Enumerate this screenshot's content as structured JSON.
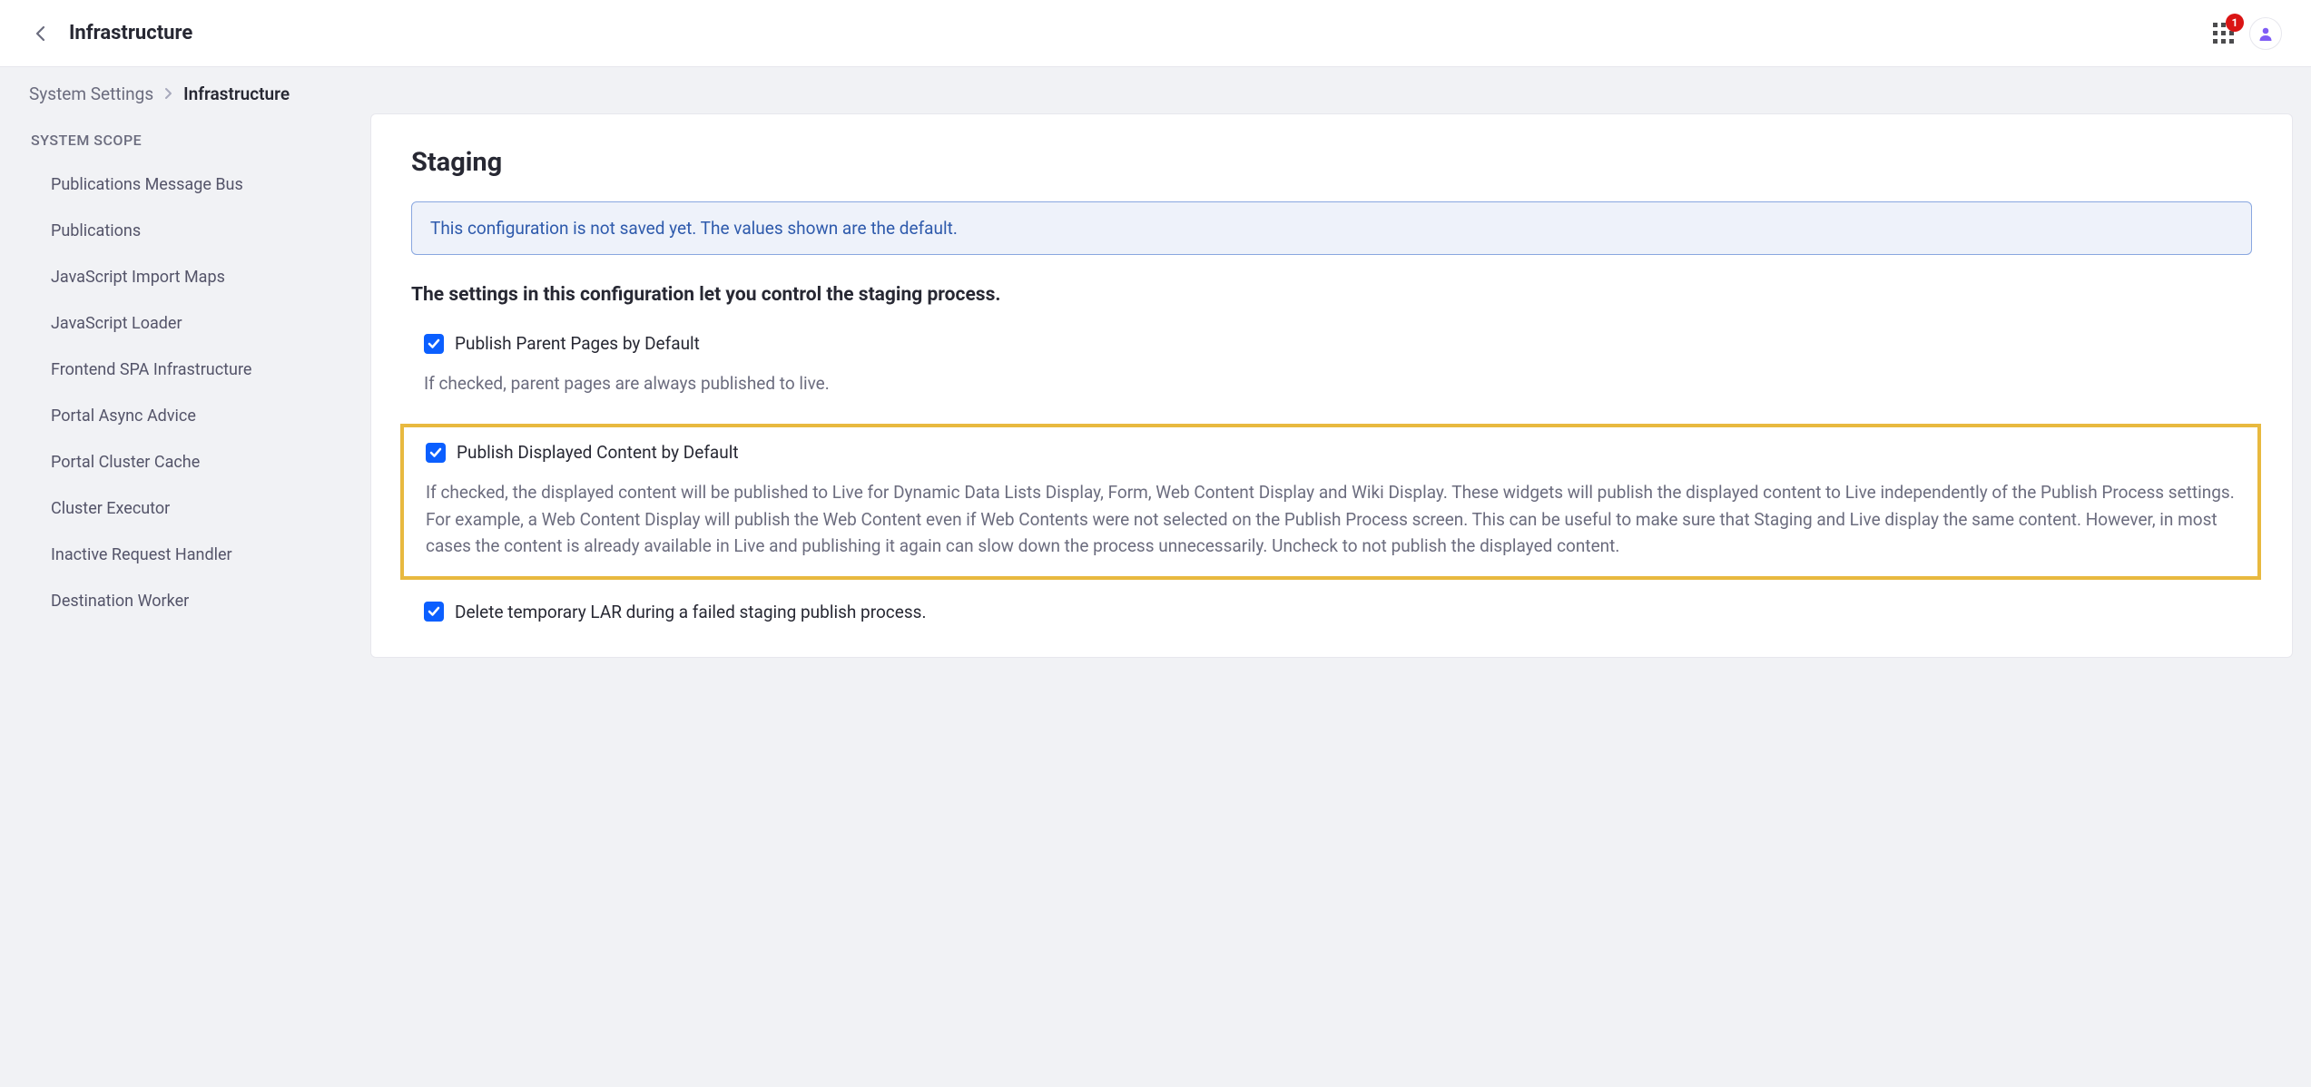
{
  "topbar": {
    "title": "Infrastructure",
    "badge": "1"
  },
  "breadcrumb": {
    "link": "System Settings",
    "current": "Infrastructure"
  },
  "sidebar": {
    "scope_label": "SYSTEM SCOPE",
    "items": [
      {
        "label": "Publications Message Bus",
        "name": "publications-message-bus"
      },
      {
        "label": "Publications",
        "name": "publications"
      },
      {
        "label": "JavaScript Import Maps",
        "name": "js-import-maps"
      },
      {
        "label": "JavaScript Loader",
        "name": "js-loader"
      },
      {
        "label": "Frontend SPA Infrastructure",
        "name": "frontend-spa"
      },
      {
        "label": "Portal Async Advice",
        "name": "portal-async-advice"
      },
      {
        "label": "Portal Cluster Cache",
        "name": "portal-cluster-cache"
      },
      {
        "label": "Cluster Executor",
        "name": "cluster-executor"
      },
      {
        "label": "Inactive Request Handler",
        "name": "inactive-request-handler"
      },
      {
        "label": "Destination Worker",
        "name": "destination-worker"
      }
    ]
  },
  "panel": {
    "title": "Staging",
    "alert": "This configuration is not saved yet. The values shown are the default.",
    "desc": "The settings in this configuration let you control the staging process.",
    "opt1": {
      "label": "Publish Parent Pages by Default",
      "help": "If checked, parent pages are always published to live."
    },
    "opt2": {
      "label": "Publish Displayed Content by Default",
      "help": "If checked, the displayed content will be published to Live for Dynamic Data Lists Display, Form, Web Content Display and Wiki Display. These widgets will publish the displayed content to Live independently of the Publish Process settings. For example, a Web Content Display will publish the Web Content even if Web Contents were not selected on the Publish Process screen. This can be useful to make sure that Staging and Live display the same content. However, in most cases the content is already available in Live and publishing it again can slow down the process unnecessarily. Uncheck to not publish the displayed content."
    },
    "opt3": {
      "label": "Delete temporary LAR during a failed staging publish process."
    }
  }
}
